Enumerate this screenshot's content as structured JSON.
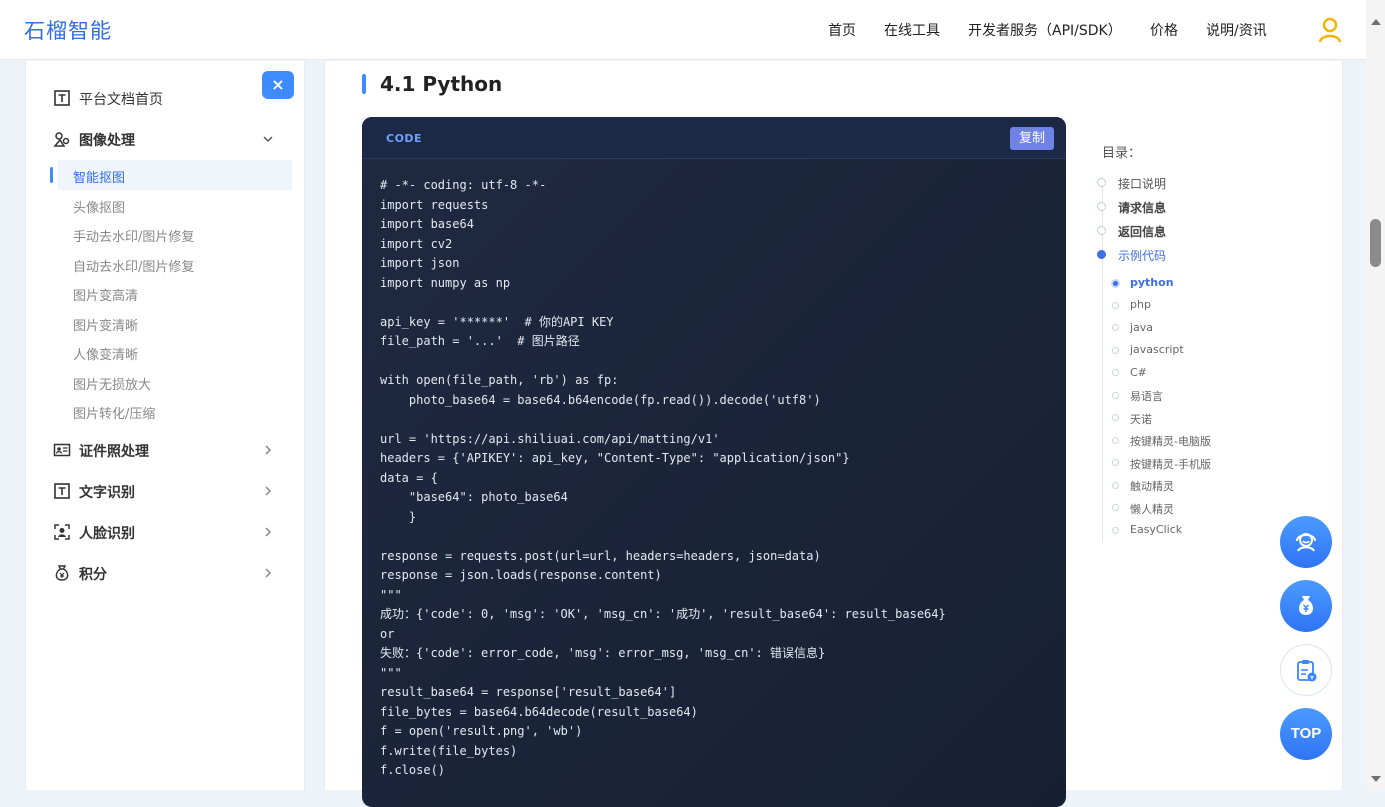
{
  "header": {
    "logo": "石榴智能",
    "nav": [
      "首页",
      "在线工具",
      "开发者服务（API/SDK）",
      "价格",
      "说明/资讯"
    ]
  },
  "sidebar": {
    "close_label": "×",
    "home": "平台文档首页",
    "image_group": "图像处理",
    "image_items": [
      "智能抠图",
      "头像抠图",
      "手动去水印/图片修复",
      "自动去水印/图片修复",
      "图片变高清",
      "图片变清晰",
      "人像变清晰",
      "图片无损放大",
      "图片转化/压缩"
    ],
    "groups": [
      "证件照处理",
      "文字识别",
      "人脸识别",
      "积分"
    ]
  },
  "main": {
    "section_title": "4.1 Python",
    "code_tag": "CODE",
    "copy_label": "复制",
    "code": "# -*- coding: utf-8 -*-\nimport requests\nimport base64\nimport cv2\nimport json\nimport numpy as np\n\napi_key = '******'  # 你的API KEY\nfile_path = '...'  # 图片路径\n\nwith open(file_path, 'rb') as fp:\n    photo_base64 = base64.b64encode(fp.read()).decode('utf8')\n\nurl = 'https://api.shiliuai.com/api/matting/v1'\nheaders = {'APIKEY': api_key, \"Content-Type\": \"application/json\"}\ndata = {\n    \"base64\": photo_base64\n    }\n\nresponse = requests.post(url=url, headers=headers, json=data)\nresponse = json.loads(response.content)\n\"\"\"\n成功：{'code': 0, 'msg': 'OK', 'msg_cn': '成功', 'result_base64': result_base64}\nor\n失败：{'code': error_code, 'msg': error_msg, 'msg_cn': 错误信息}\n\"\"\"\nresult_base64 = response['result_base64']\nfile_bytes = base64.b64decode(result_base64)\nf = open('result.png', 'wb')\nf.write(file_bytes)\nf.close()"
  },
  "toc": {
    "title": "目录：",
    "items": [
      "接口说明",
      "请求信息",
      "返回信息",
      "示例代码"
    ],
    "subitems": [
      "python",
      "php",
      "java",
      "javascript",
      "C#",
      "易语言",
      "天诺",
      "按键精灵-电脑版",
      "按键精灵-手机版",
      "触动精灵",
      "懒人精灵",
      "EasyClick"
    ]
  },
  "floating": {
    "top_label": "TOP"
  },
  "colors": {
    "accent": "#3d8bff",
    "code_bg": "#1b2438",
    "active_text": "#3d6fe6"
  }
}
